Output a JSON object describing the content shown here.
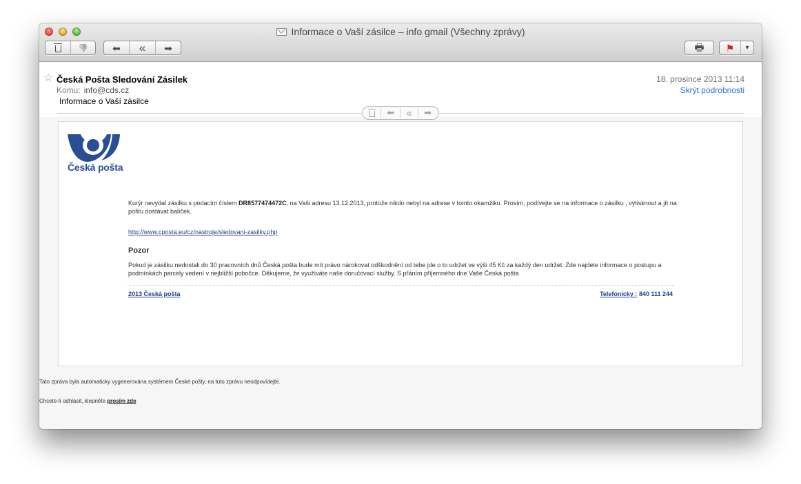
{
  "window": {
    "title": "Informace o Vaší zásilce – info gmail (Všechny zprávy)",
    "icons": {
      "envelope": "envelope-icon",
      "trash": "trash-icon",
      "junk": "thumbs-down-icon",
      "reply": "reply-arrow-icon",
      "reply_all": "reply-all-arrow-icon",
      "forward": "forward-arrow-icon",
      "print": "printer-icon",
      "flag": "flag-icon",
      "dropdown": "chevron-down-icon"
    }
  },
  "toolbar": {
    "glyphs": {
      "junk": "👎",
      "reply": "⬅",
      "reply_all": "«",
      "forward": "➡",
      "print": "🖶",
      "flag": "⚑",
      "dropdown": "▾"
    }
  },
  "header": {
    "star": "☆",
    "sender": "Česká Pošta Sledování Zásilek",
    "to_label": "Komu:",
    "to_value": "info@cds.cz",
    "subject": "Informace o Vaší zásilce",
    "date": "18. prosince 2013 11:14",
    "hide_details": "Skrýt podrobnosti"
  },
  "message": {
    "logo_text": "Česká pošta",
    "p1_before": "Kurýr nevydal zásilku s podacím číslem ",
    "tracking_number": "DR8577474472C",
    "p1_after": ", na Vaši adresu 13.12.2013, protože nikdo nebyl na adrese v tomto okamžiku. Prosím, podívejte se na informace o zásilku , vytisknout a jít na poštu dostávat balíček.",
    "link": "http://www.cposta.eu/cz/nastroje/sledovani-zasilky.php",
    "heading": "Pozor",
    "p2": "Pokud je zásilku nedostali do 30 pracovních dnů Česká pošta bude mít právo nárokovat odškodnění od tebe jde o to udržet ve výši 45 Kč za každý den udržet. Zde najdete informace o postupu a podmínkách parcely vedení v nejbližší pobočce. Děkujeme, že využíváte naše doručovací služby. S přáním příjemného dne Vaše Česká pošta",
    "footer_left": "2013 Česká pošta",
    "footer_phone_label": "Telefonicky :",
    "footer_phone": "840 111 244"
  },
  "notes": {
    "auto": "Tato zpráva byla automaticky vygenerována systémem České pošty, na tuto zprávu neodpovídejte.",
    "unsubscribe_prefix": "Chcete-li odhlásit, klepněte ",
    "unsubscribe_link": "prosím zde"
  },
  "colors": {
    "brand_blue": "#2a4e96",
    "link_blue": "#2f6fe0"
  }
}
